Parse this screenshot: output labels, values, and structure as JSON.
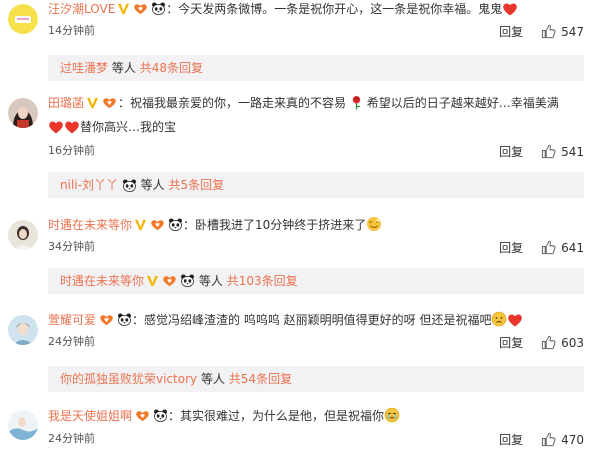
{
  "comments": [
    {
      "name": "汪汐潮LOVE",
      "text": "：今天发两条微博。一条是祝你开心，这一条是祝你幸福。鬼鬼",
      "text2": "",
      "time": "14分钟前",
      "reply": "回复",
      "likes": "547",
      "sub_name": "过哇潘梦",
      "sub_deng": "等人",
      "sub_more": "共48条回复"
    },
    {
      "name": "田璐菡",
      "text": "：祝福我最亲爱的你，一路走来真的不容易",
      "text_b": "希望以后的日子越来越好…幸福美满",
      "text2": "替你高兴…我的宝",
      "time": "16分钟前",
      "reply": "回复",
      "likes": "541",
      "sub_name": "nili-刘丫丫",
      "sub_deng": "等人",
      "sub_more": "共5条回复"
    },
    {
      "name": "时遇在未来等你",
      "text": "：卧槽我进了10分钟终于挤进来了",
      "time": "34分钟前",
      "reply": "回复",
      "likes": "641",
      "sub_name": "时遇在未来等你",
      "sub_deng": "等人",
      "sub_more": "共103条回复"
    },
    {
      "name": "萱耀可爱",
      "text": "：感觉冯绍峰渣渣的 呜呜呜 赵丽颖明明值得更好的呀 但还是祝福吧",
      "time": "24分钟前",
      "reply": "回复",
      "likes": "603",
      "sub_name": "你的孤独虽败犹荣victory",
      "sub_deng": "等人",
      "sub_more": "共54条回复"
    },
    {
      "name": "我是天使姐姐啊",
      "text": "：其实很难过，为什么是他，但是祝福你",
      "time": "24分钟前",
      "reply": "回复",
      "likes": "470"
    }
  ],
  "colors": {
    "accent": "#eb7350",
    "subbg": "#f2f2f5",
    "heart": "#e8362b",
    "gold": "#f5b400"
  }
}
